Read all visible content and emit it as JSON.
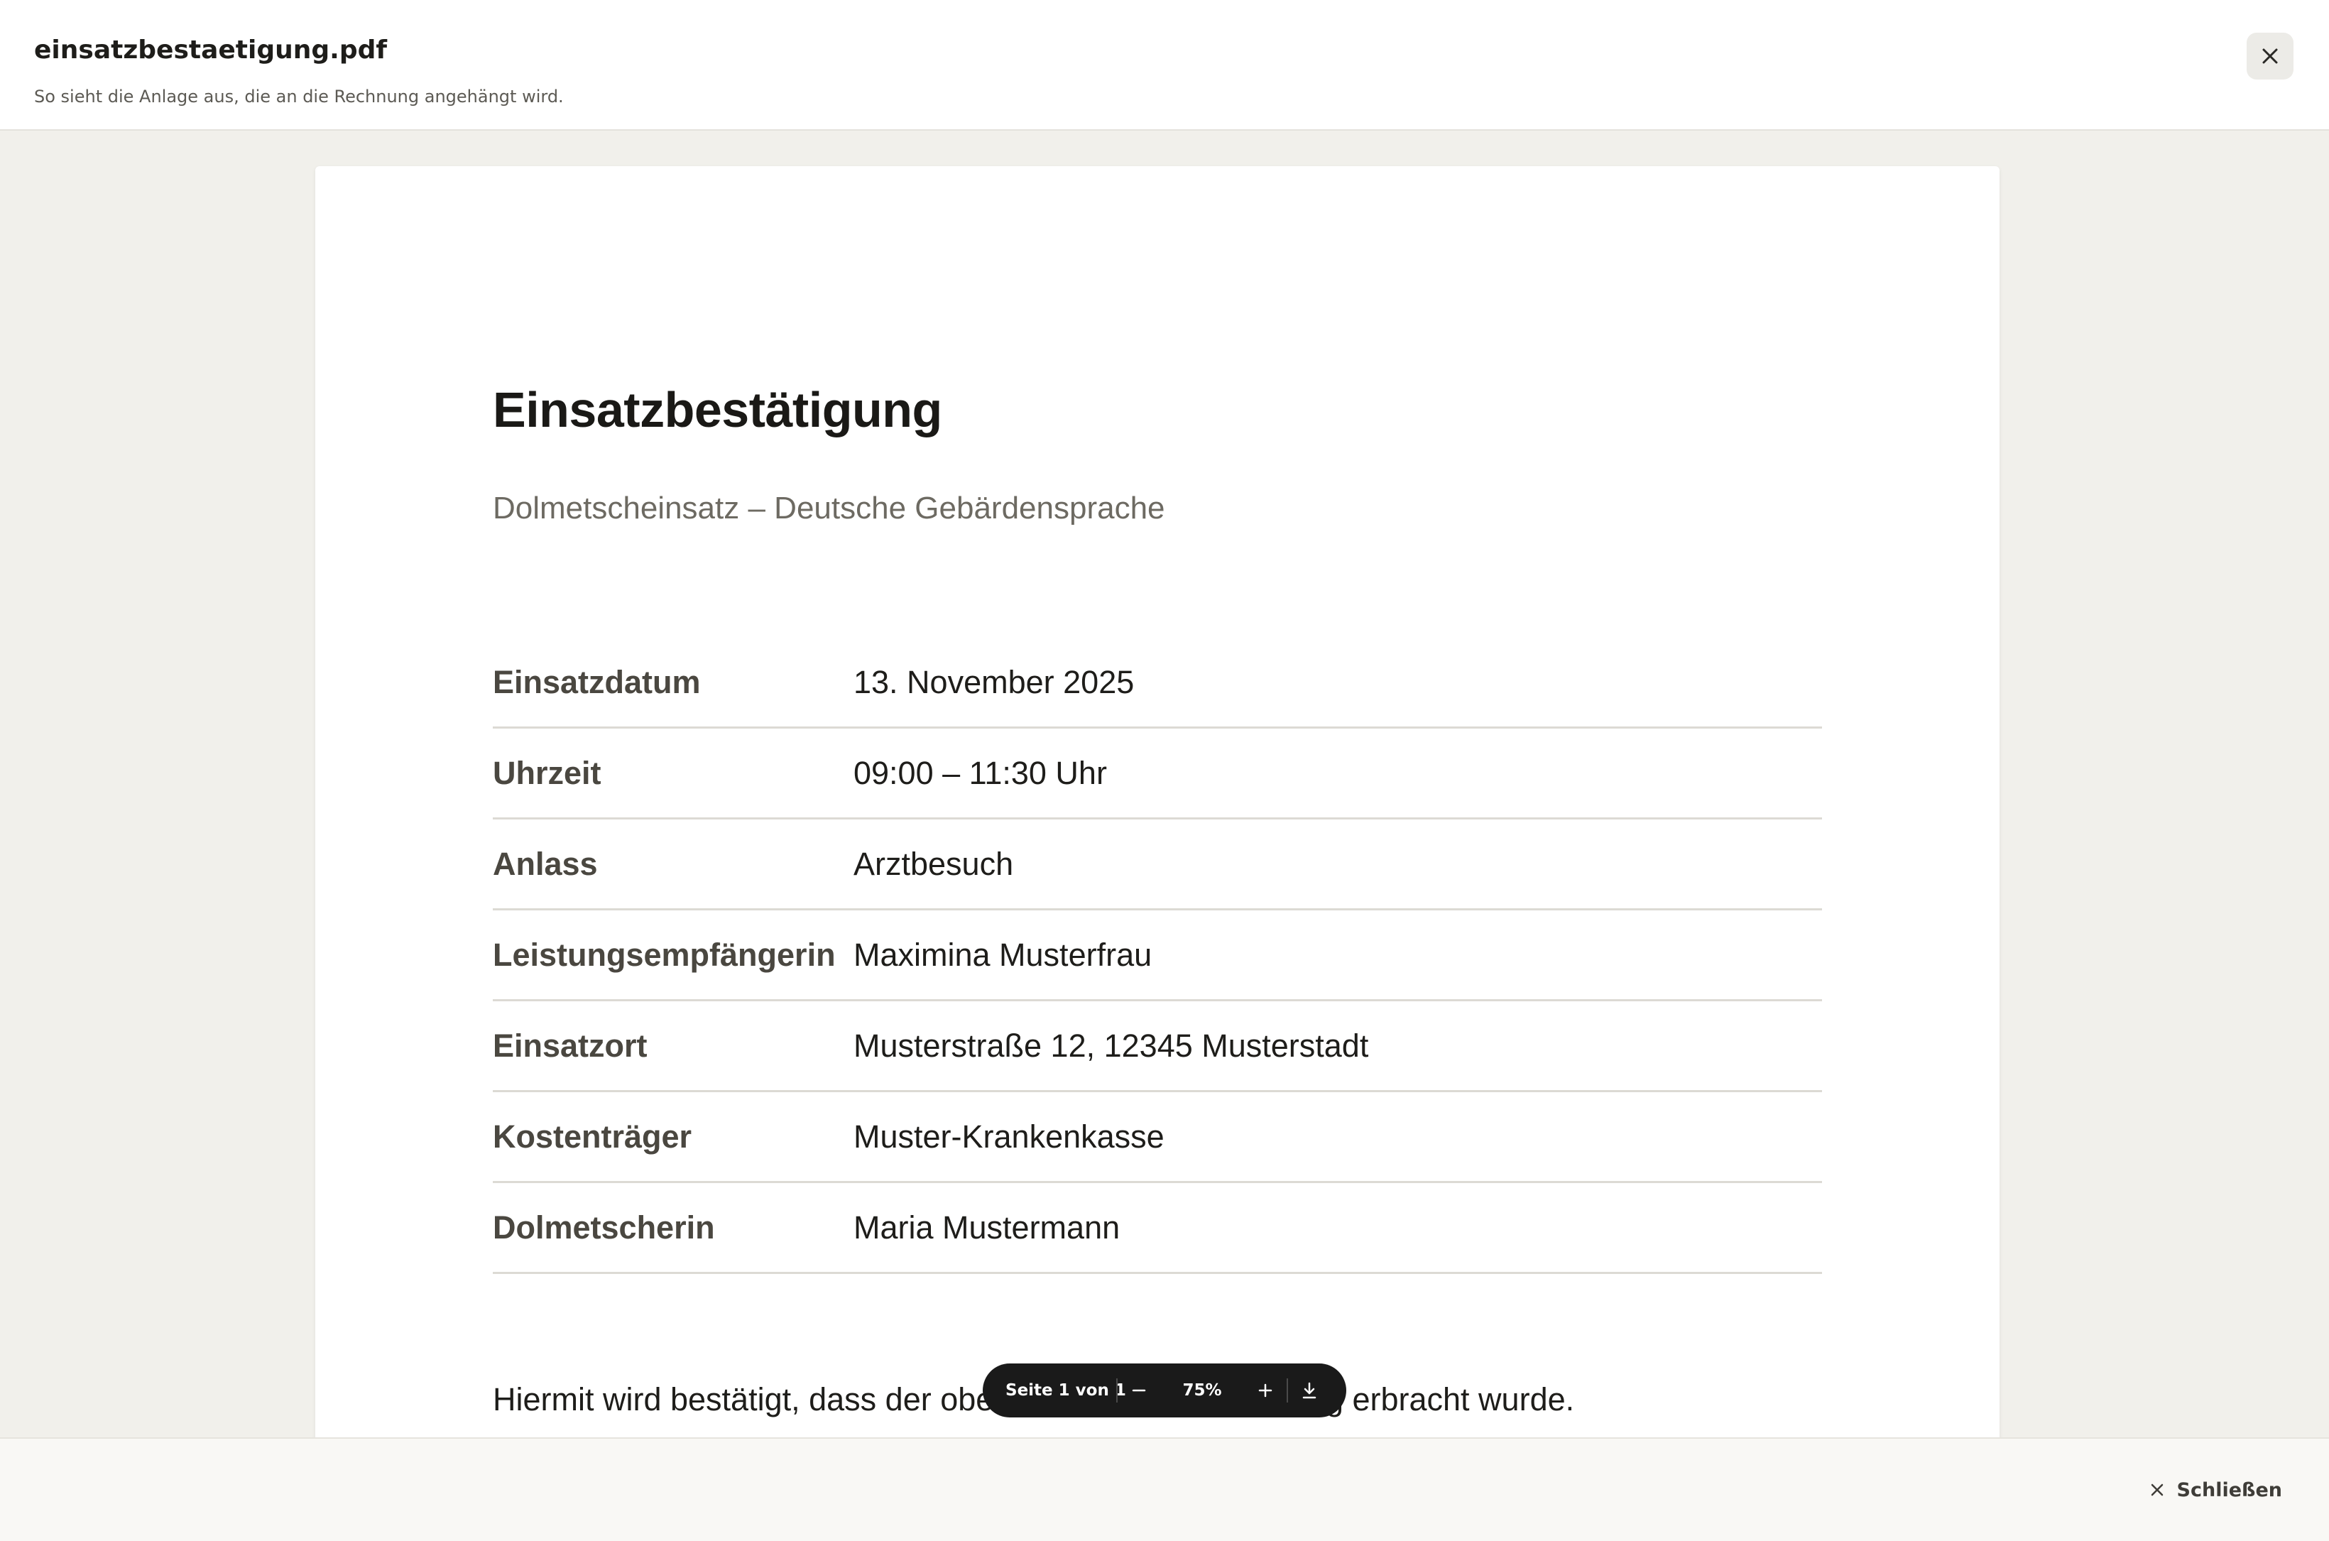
{
  "dialog": {
    "filename": "einsatzbestaetigung.pdf",
    "description": "So sieht die Anlage aus, die an die Rechnung angehängt wird.",
    "close_icon": "close-icon"
  },
  "document": {
    "title": "Einsatzbestätigung",
    "subtitle": "Dolmetscheinsatz – Deutsche Gebärdensprache",
    "details": [
      {
        "label": "Einsatzdatum",
        "value": "13. November 2025"
      },
      {
        "label": "Uhrzeit",
        "value": "09:00 – 11:30 Uhr"
      },
      {
        "label": "Anlass",
        "value": "Arztbesuch"
      },
      {
        "label": "Leistungsempfängerin",
        "value": "Maximina Musterfrau"
      },
      {
        "label": "Einsatzort",
        "value": "Musterstraße 12, 12345 Musterstadt"
      },
      {
        "label": "Kostenträger",
        "value": "Muster-Krankenkasse"
      },
      {
        "label": "Dolmetscherin",
        "value": "Maria Mustermann"
      }
    ],
    "body_text": "Hiermit wird bestätigt, dass der obe... satz in vollem Umfang erbracht wurde."
  },
  "toolbar": {
    "page_indicator": "Seite 1 von 1",
    "zoom": "75%",
    "icons": [
      "minus-icon",
      "plus-icon",
      "download-icon"
    ]
  },
  "footer": {
    "close_label": "Schließen"
  },
  "colors": {
    "backdrop": "#f1f0eb",
    "toolbar_bg": "#1a1a1a",
    "label_text": "#4a4740",
    "subtitle_text": "#6d6a62"
  }
}
